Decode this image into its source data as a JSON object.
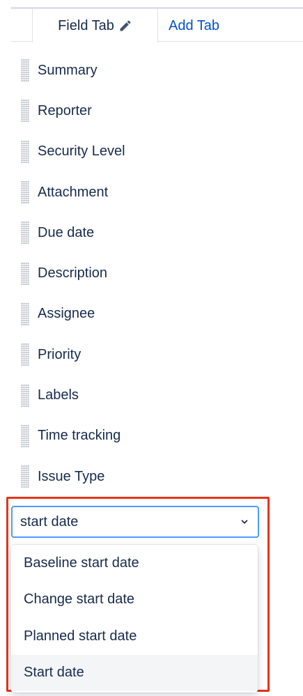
{
  "tabs": {
    "active_label": "Field Tab",
    "add_label": "Add Tab"
  },
  "fields": [
    {
      "label": "Summary"
    },
    {
      "label": "Reporter"
    },
    {
      "label": "Security Level"
    },
    {
      "label": "Attachment"
    },
    {
      "label": "Due date"
    },
    {
      "label": "Description"
    },
    {
      "label": "Assignee"
    },
    {
      "label": "Priority"
    },
    {
      "label": "Labels"
    },
    {
      "label": "Time tracking"
    },
    {
      "label": "Issue Type"
    }
  ],
  "field_select": {
    "value": "start date",
    "options": [
      {
        "label": "Baseline start date"
      },
      {
        "label": "Change start date"
      },
      {
        "label": "Planned start date"
      },
      {
        "label": "Start date"
      }
    ],
    "focused_option": "Start date"
  },
  "colors": {
    "link": "#0052cc",
    "text": "#172b4d",
    "focus_border": "#4c9aff",
    "highlight": "#e5341b",
    "option_hover": "#f4f5f7"
  }
}
